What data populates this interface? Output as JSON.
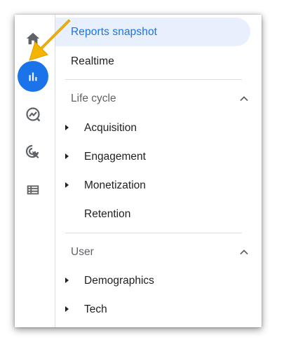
{
  "rail": {
    "items": [
      {
        "icon": "home-icon"
      },
      {
        "icon": "bar-chart-icon",
        "active": true
      },
      {
        "icon": "explore-trend-icon"
      },
      {
        "icon": "advertising-cursor-icon"
      },
      {
        "icon": "list-table-icon"
      }
    ]
  },
  "nav": {
    "reports_snapshot": "Reports snapshot",
    "realtime": "Realtime",
    "lifecycle": {
      "title": "Life cycle",
      "items": [
        "Acquisition",
        "Engagement",
        "Monetization",
        "Retention"
      ]
    },
    "user": {
      "title": "User",
      "items": [
        "Demographics",
        "Tech"
      ]
    }
  },
  "colors": {
    "accent": "#1a73e8",
    "selected_bg": "#e8f0fe",
    "arrow": "#f4b400"
  }
}
